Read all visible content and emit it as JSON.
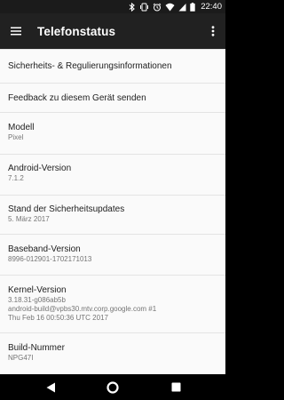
{
  "status_bar": {
    "time": "22:40",
    "icons": [
      "bluetooth-icon",
      "vibrate-icon",
      "alarm-icon",
      "wifi-icon",
      "signal-icon",
      "battery-icon"
    ]
  },
  "toolbar": {
    "title": "Telefonstatus",
    "menu_icon": "menu-icon",
    "overflow_icon": "more-vert-icon"
  },
  "items": [
    {
      "title": "Sicherheits- & Regulierungsinformationen",
      "subtitle": []
    },
    {
      "title": "Feedback zu diesem Gerät senden",
      "subtitle": []
    },
    {
      "title": "Modell",
      "subtitle": [
        "Pixel"
      ]
    },
    {
      "title": "Android-Version",
      "subtitle": [
        "7.1.2"
      ]
    },
    {
      "title": "Stand der Sicherheitsupdates",
      "subtitle": [
        "5. März 2017"
      ]
    },
    {
      "title": "Baseband-Version",
      "subtitle": [
        "8996-012901-1702171013"
      ]
    },
    {
      "title": "Kernel-Version",
      "subtitle": [
        "3.18.31-g086ab5b",
        "android-build@vpbs30.mtv.corp.google.com #1",
        "Thu Feb 16 00:50:36 UTC 2017"
      ]
    },
    {
      "title": "Build-Nummer",
      "subtitle": [
        "NPG47I"
      ]
    }
  ],
  "nav_bar": {
    "icons": [
      "back-icon",
      "home-icon",
      "recents-icon"
    ]
  },
  "colors": {
    "toolbar": "#212121",
    "status_bar": "#1b1b1b",
    "background": "#fafafa",
    "divider": "#e3e3e3",
    "title_text": "#212121",
    "subtitle_text": "#757575"
  }
}
